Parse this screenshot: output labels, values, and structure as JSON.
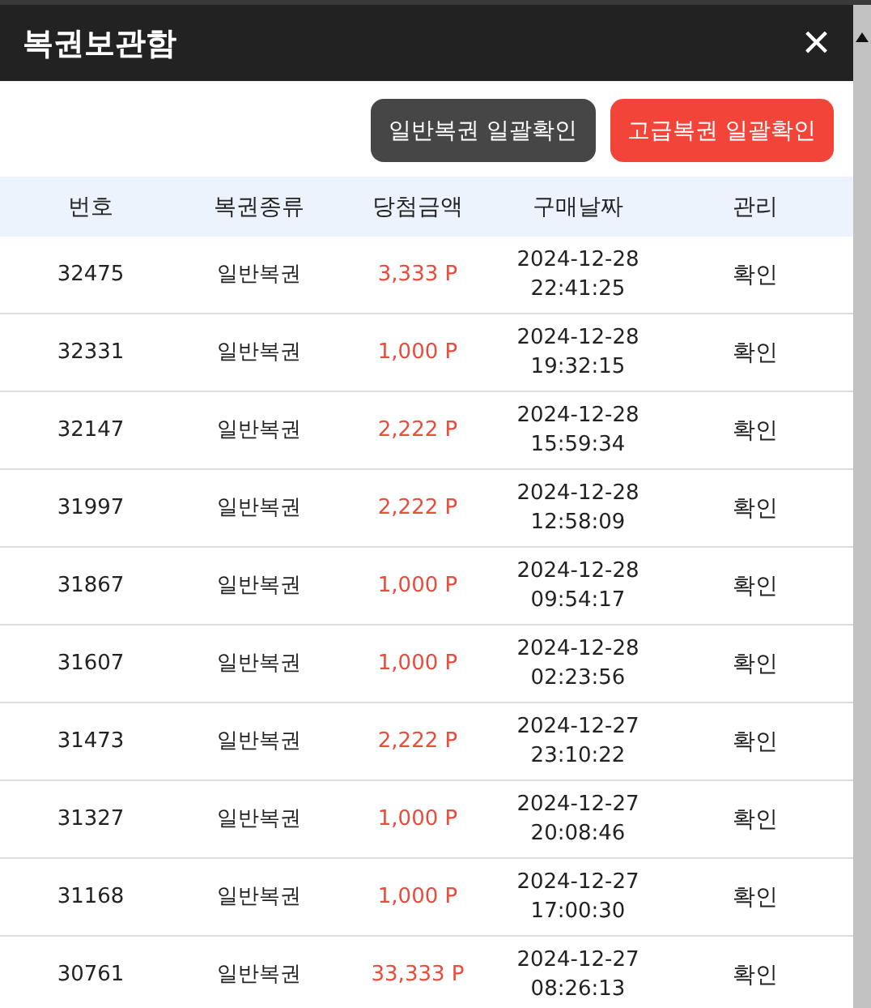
{
  "window": {
    "title": "복권보관함",
    "close": "×"
  },
  "buttons": [
    {
      "label": "일반복권 일괄확인",
      "kind": "dark"
    },
    {
      "label": "고급복권 일괄확인",
      "kind": "red"
    }
  ],
  "table": {
    "columns": [
      "번호",
      "복권종류",
      "당첨금액",
      "구매날짜",
      "관리"
    ],
    "rows": [
      {
        "number": "32475",
        "type": "일반복권",
        "amount": "3,333 P",
        "date": "2024-12-28",
        "time": "22:41:25",
        "action": "확인"
      },
      {
        "number": "32331",
        "type": "일반복권",
        "amount": "1,000 P",
        "date": "2024-12-28",
        "time": "19:32:15",
        "action": "확인"
      },
      {
        "number": "32147",
        "type": "일반복권",
        "amount": "2,222 P",
        "date": "2024-12-28",
        "time": "15:59:34",
        "action": "확인"
      },
      {
        "number": "31997",
        "type": "일반복권",
        "amount": "2,222 P",
        "date": "2024-12-28",
        "time": "12:58:09",
        "action": "확인"
      },
      {
        "number": "31867",
        "type": "일반복권",
        "amount": "1,000 P",
        "date": "2024-12-28",
        "time": "09:54:17",
        "action": "확인"
      },
      {
        "number": "31607",
        "type": "일반복권",
        "amount": "1,000 P",
        "date": "2024-12-28",
        "time": "02:23:56",
        "action": "확인"
      },
      {
        "number": "31473",
        "type": "일반복권",
        "amount": "2,222 P",
        "date": "2024-12-27",
        "time": "23:10:22",
        "action": "확인"
      },
      {
        "number": "31327",
        "type": "일반복권",
        "amount": "1,000 P",
        "date": "2024-12-27",
        "time": "20:08:46",
        "action": "확인"
      },
      {
        "number": "31168",
        "type": "일반복권",
        "amount": "1,000 P",
        "date": "2024-12-27",
        "time": "17:00:30",
        "action": "확인"
      },
      {
        "number": "30761",
        "type": "일반복권",
        "amount": "33,333 P",
        "date": "2024-12-27",
        "time": "08:26:13",
        "action": "확인"
      }
    ]
  }
}
